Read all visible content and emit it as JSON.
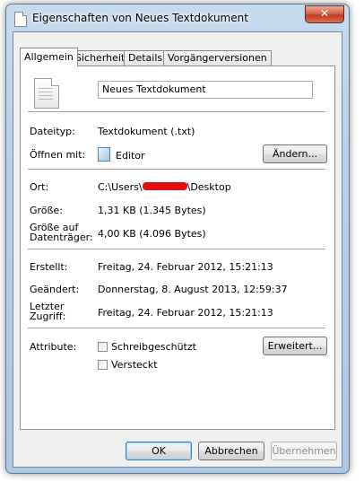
{
  "window": {
    "title": "Eigenschaften von Neues Textdokument",
    "close_glyph": "✕"
  },
  "tabs": [
    {
      "label": "Allgemein"
    },
    {
      "label": "Sicherheit"
    },
    {
      "label": "Details"
    },
    {
      "label": "Vorgängerversionen"
    }
  ],
  "general": {
    "filename": "Neues Textdokument",
    "filetype_label": "Dateityp:",
    "filetype_value": "Textdokument (.txt)",
    "openwith_label": "Öffnen mit:",
    "openwith_value": "Editor",
    "change_button": "Ändern...",
    "location_label": "Ort:",
    "location_prefix": "C:\\Users\\",
    "location_suffix": "\\Desktop",
    "size_label": "Größe:",
    "size_value": "1,31 KB (1.345 Bytes)",
    "disksize_label_1": "Größe auf",
    "disksize_label_2": "Datenträger:",
    "disksize_value": "4,00 KB (4.096 Bytes)",
    "created_label": "Erstellt:",
    "created_value": "Freitag, 24. Februar 2012, 15:21:13",
    "modified_label": "Geändert:",
    "modified_value": "Donnerstag, 8. August 2013, 12:59:37",
    "accessed_label_1": "Letzter",
    "accessed_label_2": "Zugriff:",
    "accessed_value": "Freitag, 24. Februar 2012, 15:21:13",
    "attributes_label": "Attribute:",
    "readonly_label": "Schreibgeschützt",
    "hidden_label": "Versteckt",
    "advanced_button": "Erweitert..."
  },
  "footer": {
    "ok": "OK",
    "cancel": "Abbrechen",
    "apply": "Übernehmen"
  },
  "colors": {
    "redaction": "#e30f0f",
    "close_button": "#c0391c",
    "title_bar": "#b9d1ea"
  }
}
